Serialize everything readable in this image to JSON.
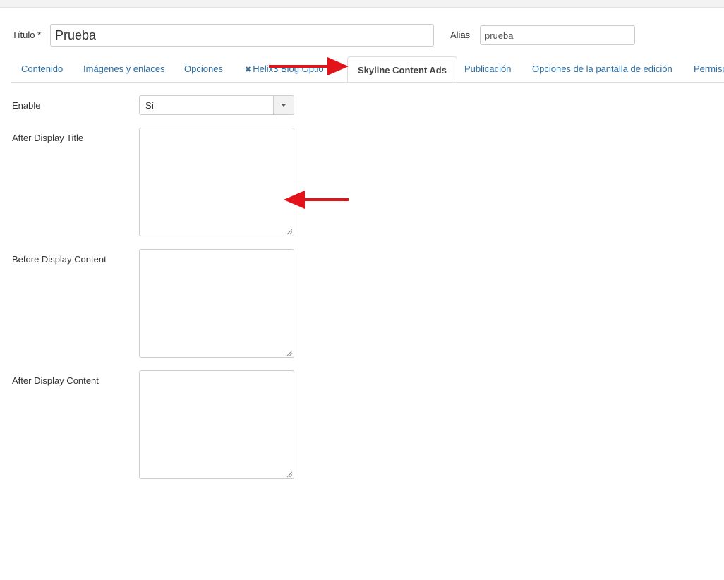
{
  "header": {
    "title_label": "Título *",
    "title_value": "Prueba",
    "alias_label": "Alias",
    "alias_value": "prueba"
  },
  "tabs": [
    {
      "label": "Contenido",
      "active": false
    },
    {
      "label": "Imágenes y enlaces",
      "active": false
    },
    {
      "label": "Opciones",
      "active": false
    },
    {
      "label": "Helix3 Blog Optio",
      "active": false,
      "icon": "joomla-icon"
    },
    {
      "label": "Skyline Content Ads",
      "active": true
    },
    {
      "label": "Publicación",
      "active": false
    },
    {
      "label": "Opciones de la pantalla de edición",
      "active": false
    },
    {
      "label": "Permiso",
      "active": false
    }
  ],
  "form": {
    "enable": {
      "label": "Enable",
      "value": "Sí"
    },
    "after_display_title": {
      "label": "After Display Title",
      "value": ""
    },
    "before_display_content": {
      "label": "Before Display Content",
      "value": ""
    },
    "after_display_content": {
      "label": "After Display Content",
      "value": ""
    }
  },
  "colors": {
    "link": "#2a6ea5",
    "annotation_arrow": "#e3131b"
  }
}
